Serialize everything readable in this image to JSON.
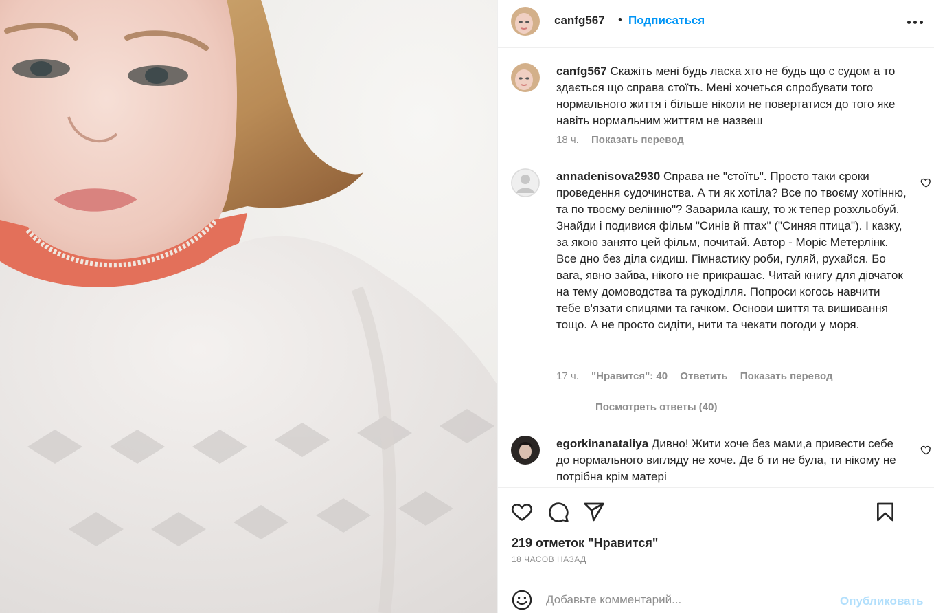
{
  "post": {
    "username": "canfg567",
    "separator": "•",
    "follow_label": "Подписаться",
    "more_icon": "more-horizontal-icon"
  },
  "comments": [
    {
      "username": "canfg567",
      "text": "Скажіть мені будь ласка хто не будь що с судом а то здається що справа стоїть. Мені хочеться спробувати того нормального життя і більше ніколи не повертатися до того яке навіть нормальним життям не назвеш",
      "time": "18 ч.",
      "translate": "Показать перевод"
    },
    {
      "username": "annadenisova2930",
      "text": "Справа не \"стоїть\". Просто таки сроки проведення судочинства. А ти як хотіла? Все по твоєму хотінню, та по твоєму велінню\"? Заварила кашу, то ж тепер розхльобуй. Знайди і подивися фільм \"Синів й птах\" (\"Синяя птица\"). І казку, за якою занято цей фільм, почитай. Автор - Моріс Метерлінк. Все дно без діла сидиш. Гімнастику роби, гуляй, рухайся. Бо вага, явно зайва, нікого не прикрашає. Читай книгу для дівчаток на тему домоводства та рукоділля. Попроси когось навчити тебе в'язати спицями та гачком. Основи шиття та вишивання тощо. А не просто сидіти, нити та чекати погоди у моря.",
      "time": "17 ч.",
      "likes": "\"Нравится\": 40",
      "reply": "Ответить",
      "translate": "Показать перевод",
      "view_replies": "Посмотреть ответы (40)"
    },
    {
      "username": "egorkinanataliya",
      "text": "Дивно! Жити хоче без мами,а привести себе до нормального вигляду не хоче. Де б ти не була, ти нікому не потрібна крім матері"
    }
  ],
  "actions": {
    "like_icon": "heart-icon",
    "comment_icon": "comment-icon",
    "share_icon": "send-icon",
    "save_icon": "bookmark-icon"
  },
  "likes_text": "219 отметок \"Нравится\"",
  "time_ago": "18 ЧАСОВ НАЗАД",
  "add_comment": {
    "placeholder": "Добавьте комментарий...",
    "post_label": "Опубликовать",
    "emoji_icon": "emoji-icon"
  },
  "colors": {
    "accent": "#0095f6",
    "muted": "#8e8e8e",
    "post_disabled": "#b2dffc"
  }
}
